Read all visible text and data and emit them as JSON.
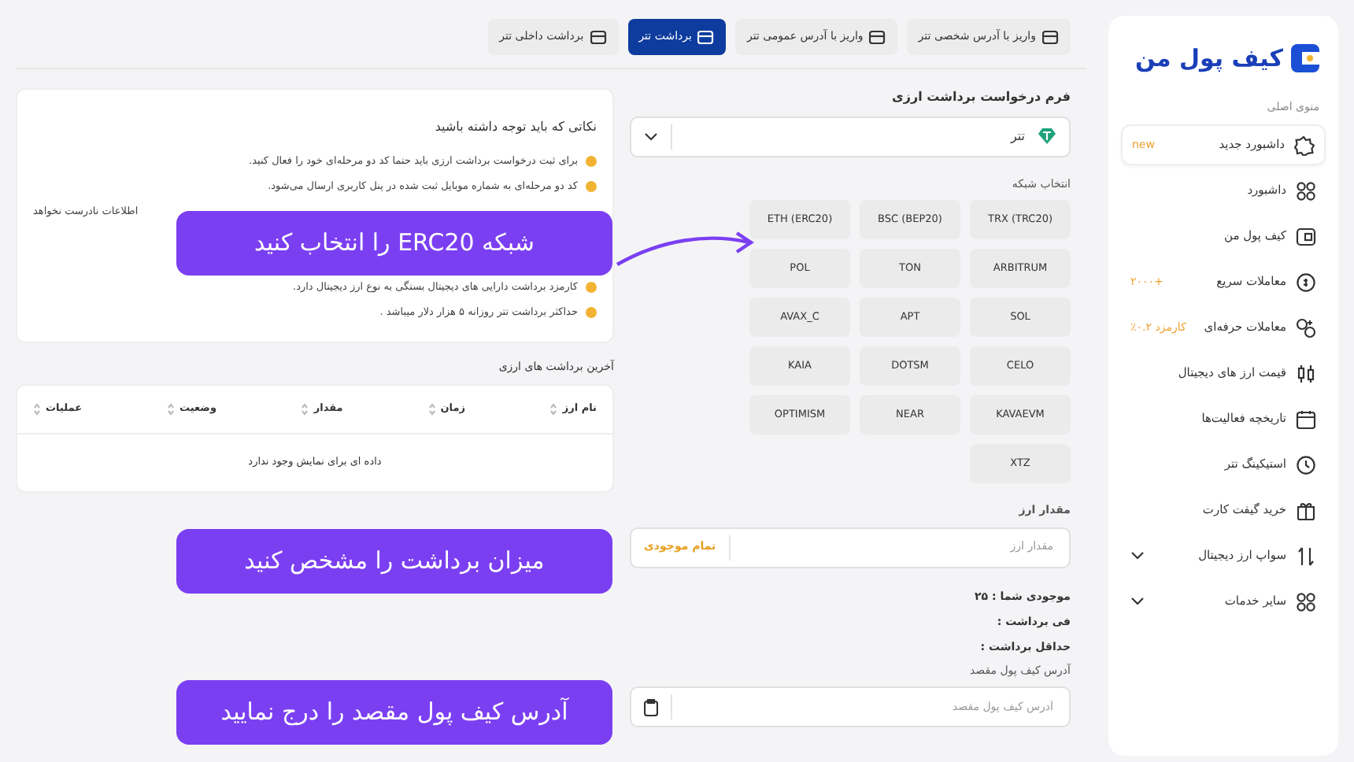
{
  "sidebar": {
    "logo": "کیف پول من",
    "section_label": "منوی اصلی",
    "items": [
      {
        "label": "داشبورد جدید",
        "badge": "new",
        "selected": true,
        "expandable": false
      },
      {
        "label": "داشبورد",
        "selected": false,
        "expandable": false
      },
      {
        "label": "کیف پول من",
        "selected": false,
        "expandable": false
      },
      {
        "label": "معاملات سریع",
        "badge": "+۲۰۰۰",
        "selected": false,
        "expandable": false
      },
      {
        "label": "معاملات حرفه‌ای",
        "badge": "کارمزد ۰.۲٪",
        "selected": false,
        "expandable": false
      },
      {
        "label": "قیمت ارز های دیجیتال",
        "selected": false,
        "expandable": false
      },
      {
        "label": "تاریخچه فعالیت‌ها",
        "selected": false,
        "expandable": false
      },
      {
        "label": "استیکینگ تتر",
        "selected": false,
        "expandable": false
      },
      {
        "label": "خرید گیفت کارت",
        "selected": false,
        "expandable": false
      },
      {
        "label": "سواپ ارز دیجیتال",
        "selected": false,
        "expandable": true
      },
      {
        "label": "سایر خدمات",
        "selected": false,
        "expandable": true
      }
    ]
  },
  "tabs": [
    {
      "label": "واریز با آدرس شخصی تتر",
      "selected": false
    },
    {
      "label": "واریز با آدرس عمومی تتر",
      "selected": false
    },
    {
      "label": "برداشت تتر",
      "selected": true
    },
    {
      "label": "برداشت داخلی تتر",
      "selected": false
    }
  ],
  "form": {
    "title": "فرم درخواست برداشت ارزی",
    "currency": "تتر",
    "network_label": "انتخاب شبکه",
    "networks": [
      {
        "label": "TRX (TRC20)",
        "selected": false
      },
      {
        "label": "BSC (BEP20)",
        "selected": false
      },
      {
        "label": "ETH (ERC20)",
        "selected": false
      },
      {
        "label": "ARBITRUM",
        "selected": false
      },
      {
        "label": "TON",
        "selected": false
      },
      {
        "label": "POL",
        "selected": false
      },
      {
        "label": "SOL",
        "selected": false
      },
      {
        "label": "APT",
        "selected": false
      },
      {
        "label": "AVAX_C",
        "selected": false
      },
      {
        "label": "CELO",
        "selected": false
      },
      {
        "label": "DOTSM",
        "selected": false
      },
      {
        "label": "KAIA",
        "selected": false
      },
      {
        "label": "KAVAEVM",
        "selected": false
      },
      {
        "label": "NEAR",
        "selected": false
      },
      {
        "label": "OPTIMISM",
        "selected": false
      },
      {
        "label": "XTZ",
        "selected": false
      }
    ],
    "amount_label": "مقدار ارز",
    "amount_placeholder": "مقدار ارز",
    "max_button": "تمام موجودی",
    "info": [
      "موجودی شما : ۲۵",
      "فی برداشت :",
      "حداقل برداشت :"
    ],
    "address_label": "آدرس کیف پول مقصد",
    "address_placeholder": "آدرس کیف پول مقصد"
  },
  "notes": {
    "title": "نکاتی که باید توجه داشته باشید",
    "items": [
      {
        "kind": "full",
        "text": "برای ثبت درخواست برداشت ارزی باید حتما کد دو مرحله‌ای خود را فعال کنید."
      },
      {
        "kind": "full",
        "text": "کد دو مرحله‌ای به شماره موبایل ثبت شده در پنل کاربری ارسال می‌شود."
      },
      {
        "kind": "partial",
        "text": "اطلاعات نادرست نخواهد"
      },
      {
        "kind": "hidden"
      },
      {
        "kind": "hidden"
      },
      {
        "kind": "full",
        "text": "کارمزد برداشت دارایی های دیجیتال بستگی به نوع ارز دیجیتال دارد."
      },
      {
        "kind": "full",
        "text": "حداکثر برداشت تتر روزانه ۵ هزار دلار میباشد ."
      }
    ]
  },
  "history": {
    "title": "آخرین برداشت های ارزی",
    "columns": [
      "نام ارز",
      "زمان",
      "مقدار",
      "وضعیت",
      "عملیات"
    ],
    "empty": "داده ای برای نمایش وجود ندارد"
  },
  "callouts": [
    "شبکه ERC20 را انتخاب کنید",
    "میزان برداشت را مشخص کنید",
    "آدرس کیف پول مقصد را درج نمایید"
  ]
}
